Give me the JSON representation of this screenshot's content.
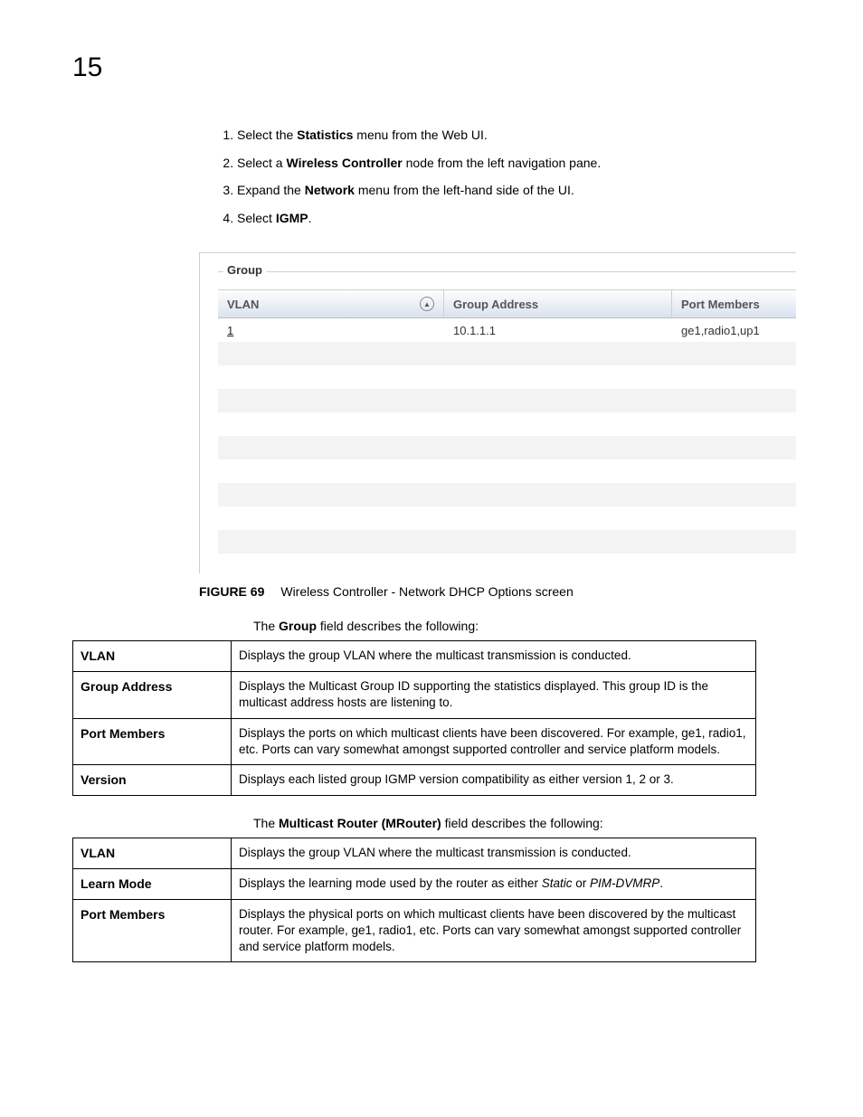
{
  "chapter_number": "15",
  "steps": [
    {
      "pre": "Select the ",
      "bold": "Statistics",
      "post": " menu from the Web UI."
    },
    {
      "pre": "Select a ",
      "bold": "Wireless Controller",
      "post": " node from the left navigation pane."
    },
    {
      "pre": "Expand the ",
      "bold": "Network",
      "post": " menu from the left-hand side of the UI."
    },
    {
      "pre": "Select ",
      "bold": "IGMP",
      "post": "."
    }
  ],
  "screenshot": {
    "panel_title": "Group",
    "columns": {
      "vlan": "VLAN",
      "group_address": "Group Address",
      "port_members": "Port Members"
    },
    "sort_glyph": "▲",
    "rows": [
      {
        "vlan": "1",
        "ga": "10.1.1.1",
        "pm": "ge1,radio1,up1"
      },
      {
        "vlan": "",
        "ga": "",
        "pm": ""
      },
      {
        "vlan": "",
        "ga": "",
        "pm": ""
      },
      {
        "vlan": "",
        "ga": "",
        "pm": ""
      },
      {
        "vlan": "",
        "ga": "",
        "pm": ""
      },
      {
        "vlan": "",
        "ga": "",
        "pm": ""
      },
      {
        "vlan": "",
        "ga": "",
        "pm": ""
      },
      {
        "vlan": "",
        "ga": "",
        "pm": ""
      },
      {
        "vlan": "",
        "ga": "",
        "pm": ""
      },
      {
        "vlan": "",
        "ga": "",
        "pm": ""
      }
    ]
  },
  "figure": {
    "label": "FIGURE 69",
    "caption": "Wireless Controller - Network DHCP Options screen"
  },
  "group_intro": {
    "pre": "The ",
    "bold": "Group",
    "post": " field describes the following:"
  },
  "group_table": [
    {
      "term": "VLAN",
      "desc": "Displays the group VLAN where the multicast transmission is conducted."
    },
    {
      "term": "Group Address",
      "desc": "Displays the Multicast Group ID supporting the statistics displayed. This group ID is the multicast address hosts are listening to."
    },
    {
      "term": "Port Members",
      "desc": "Displays the ports on which multicast clients have been discovered. For example, ge1, radio1, etc. Ports can vary somewhat amongst supported controller and service platform models."
    },
    {
      "term": "Version",
      "desc": "Displays each listed group IGMP version compatibility as either version 1, 2 or 3."
    }
  ],
  "mrouter_intro": {
    "pre": "The ",
    "bold": "Multicast Router (MRouter)",
    "post": " field describes the following:"
  },
  "mrouter_table": [
    {
      "term": "VLAN",
      "desc": "Displays the group VLAN where the multicast transmission is conducted."
    },
    {
      "term": "Learn Mode",
      "desc_pre": "Displays the learning mode used by the router as either ",
      "italic1": "Static",
      "desc_mid": " or ",
      "italic2": "PIM-DVMRP",
      "desc_post": "."
    },
    {
      "term": "Port Members",
      "desc": "Displays the physical ports on which multicast clients have been discovered by the multicast router. For example, ge1, radio1, etc. Ports can vary somewhat amongst supported controller and service platform models."
    }
  ]
}
